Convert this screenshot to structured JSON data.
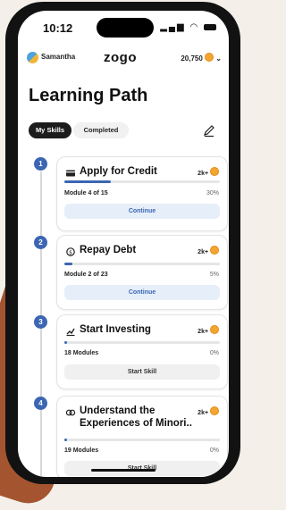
{
  "status": {
    "time": "10:12",
    "signal": "..ıl"
  },
  "header": {
    "username": "Samantha",
    "brand": "zogo",
    "coins": "20,750"
  },
  "page": {
    "title": "Learning Path"
  },
  "tabs": [
    {
      "label": "My Skills"
    },
    {
      "label": "Completed"
    }
  ],
  "skills": [
    {
      "number": "1",
      "title": "Apply for Credit",
      "reward": "2k+",
      "progress_label": "Module 4 of 15",
      "percent_label": "30%",
      "progress": 0.3,
      "action": "Continue"
    },
    {
      "number": "2",
      "title": "Repay Debt",
      "reward": "2k+",
      "progress_label": "Module 2 of 23",
      "percent_label": "5%",
      "progress": 0.05,
      "action": "Continue"
    },
    {
      "number": "3",
      "title": "Start Investing",
      "reward": "2k+",
      "progress_label": "18 Modules",
      "percent_label": "0%",
      "progress": 0.0,
      "action": "Start Skill"
    },
    {
      "number": "4",
      "title": "Understand the Experiences of Minori..",
      "reward": "2k+",
      "progress_label": "19 Modules",
      "percent_label": "0%",
      "progress": 0.0,
      "action": "Start Skill"
    }
  ],
  "colors": {
    "accent": "#3c66b3",
    "coin": "#f2a531",
    "background_shape": "#a4552f"
  }
}
